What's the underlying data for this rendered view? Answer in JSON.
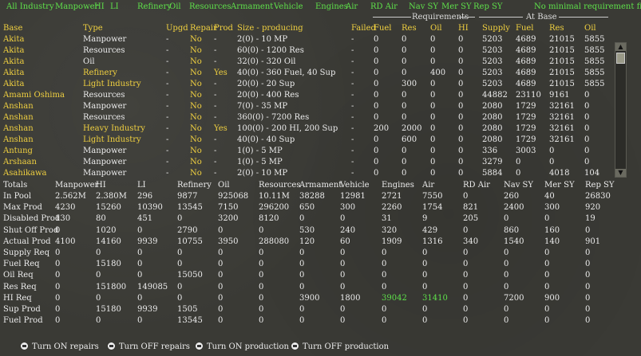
{
  "filters": [
    "All Industry",
    "Manpower",
    "HI",
    "LI",
    "Refinery",
    "Oil",
    "Resources",
    "Armament",
    "Vehicle",
    "Engines",
    "Air",
    "RD Air",
    "Nav SY",
    "Mer SY",
    "Rep SY"
  ],
  "filter_note": "No minimal requirement filter",
  "group_headers": {
    "requirements": "Requirements",
    "at_base": "At Base"
  },
  "columns": [
    "Base",
    "Type",
    "Upgd",
    "Repair",
    "Prod",
    "Size - producing",
    "Failed",
    "Fuel",
    "Res",
    "Oil",
    "HI",
    "Supply",
    "Fuel",
    "Res",
    "Oil"
  ],
  "rows": [
    {
      "base": "Akita",
      "type": "Manpower",
      "upgd": "-",
      "repair": "No",
      "prod": "-",
      "size": "2(0) - 10 MP",
      "failed": "-",
      "rfuel": "0",
      "rres": "0",
      "roil": "0",
      "rhi": "0",
      "supply": "5203",
      "fuel": "4689",
      "res": "21015",
      "oil": "5855",
      "color": "yel"
    },
    {
      "base": "Akita",
      "type": "Resources",
      "upgd": "-",
      "repair": "No",
      "prod": "-",
      "size": "60(0) - 1200 Res",
      "failed": "-",
      "rfuel": "0",
      "rres": "0",
      "roil": "0",
      "rhi": "0",
      "supply": "5203",
      "fuel": "4689",
      "res": "21015",
      "oil": "5855",
      "color": "yel"
    },
    {
      "base": "Akita",
      "type": "Oil",
      "upgd": "-",
      "repair": "No",
      "prod": "-",
      "size": "32(0) - 320 Oil",
      "failed": "-",
      "rfuel": "0",
      "rres": "0",
      "roil": "0",
      "rhi": "0",
      "supply": "5203",
      "fuel": "4689",
      "res": "21015",
      "oil": "5855",
      "color": "yel"
    },
    {
      "base": "Akita",
      "type": "Refinery",
      "upgd": "-",
      "repair": "No",
      "prod": "Yes",
      "size": "40(0) - 360 Fuel, 40 Sup",
      "failed": "-",
      "rfuel": "0",
      "rres": "0",
      "roil": "400",
      "rhi": "0",
      "supply": "5203",
      "fuel": "4689",
      "res": "21015",
      "oil": "5855",
      "color": "yel",
      "typecolor": "yel"
    },
    {
      "base": "Akita",
      "type": "Light Industry",
      "upgd": "-",
      "repair": "No",
      "prod": "-",
      "size": "20(0) - 20 Sup",
      "failed": "-",
      "rfuel": "0",
      "rres": "300",
      "roil": "0",
      "rhi": "0",
      "supply": "5203",
      "fuel": "4689",
      "res": "21015",
      "oil": "5855",
      "color": "yel",
      "typecolor": "yel"
    },
    {
      "base": "Amami Oshima",
      "type": "Resources",
      "upgd": "-",
      "repair": "No",
      "prod": "-",
      "size": "20(0) - 400 Res",
      "failed": "-",
      "rfuel": "0",
      "rres": "0",
      "roil": "0",
      "rhi": "0",
      "supply": "44882",
      "fuel": "23110",
      "res": "9161",
      "oil": "0",
      "color": "yel"
    },
    {
      "base": "Anshan",
      "type": "Manpower",
      "upgd": "-",
      "repair": "No",
      "prod": "-",
      "size": "7(0) - 35 MP",
      "failed": "-",
      "rfuel": "0",
      "rres": "0",
      "roil": "0",
      "rhi": "0",
      "supply": "2080",
      "fuel": "1729",
      "res": "32161",
      "oil": "0",
      "color": "yel"
    },
    {
      "base": "Anshan",
      "type": "Resources",
      "upgd": "-",
      "repair": "No",
      "prod": "-",
      "size": "360(0) - 7200 Res",
      "failed": "-",
      "rfuel": "0",
      "rres": "0",
      "roil": "0",
      "rhi": "0",
      "supply": "2080",
      "fuel": "1729",
      "res": "32161",
      "oil": "0",
      "color": "yel"
    },
    {
      "base": "Anshan",
      "type": "Heavy Industry",
      "upgd": "-",
      "repair": "No",
      "prod": "Yes",
      "size": "100(0) - 200 HI, 200 Sup",
      "failed": "-",
      "rfuel": "200",
      "rres": "2000",
      "roil": "0",
      "rhi": "0",
      "supply": "2080",
      "fuel": "1729",
      "res": "32161",
      "oil": "0",
      "color": "yel",
      "typecolor": "yel"
    },
    {
      "base": "Anshan",
      "type": "Light Industry",
      "upgd": "-",
      "repair": "No",
      "prod": "-",
      "size": "40(0) - 40 Sup",
      "failed": "-",
      "rfuel": "0",
      "rres": "600",
      "roil": "0",
      "rhi": "0",
      "supply": "2080",
      "fuel": "1729",
      "res": "32161",
      "oil": "0",
      "color": "yel",
      "typecolor": "yel"
    },
    {
      "base": "Antung",
      "type": "Manpower",
      "upgd": "-",
      "repair": "No",
      "prod": "-",
      "size": "1(0) - 5 MP",
      "failed": "-",
      "rfuel": "0",
      "rres": "0",
      "roil": "0",
      "rhi": "0",
      "supply": "336",
      "fuel": "3003",
      "res": "0",
      "oil": "0",
      "color": "yel"
    },
    {
      "base": "Arshaan",
      "type": "Manpower",
      "upgd": "-",
      "repair": "No",
      "prod": "-",
      "size": "1(0) - 5 MP",
      "failed": "-",
      "rfuel": "0",
      "rres": "0",
      "roil": "0",
      "rhi": "0",
      "supply": "3279",
      "fuel": "0",
      "res": "0",
      "oil": "0",
      "color": "yel"
    },
    {
      "base": "Asahikawa",
      "type": "Manpower",
      "upgd": "-",
      "repair": "No",
      "prod": "-",
      "size": "2(0) - 10 MP",
      "failed": "-",
      "rfuel": "0",
      "rres": "0",
      "roil": "0",
      "rhi": "0",
      "supply": "5884",
      "fuel": "0",
      "res": "4018",
      "oil": "104",
      "color": "yel"
    }
  ],
  "stats_columns": [
    "Totals",
    "Manpower",
    "HI",
    "LI",
    "Refinery",
    "Oil",
    "Resources",
    "Armament",
    "Vehicle",
    "Engines",
    "Air",
    "RD Air",
    "Nav SY",
    "Mer SY",
    "Rep SY"
  ],
  "stats": [
    [
      "In Pool",
      "2.562M",
      "2.380M",
      "296",
      "9877",
      "925068",
      "10.11M",
      "38288",
      "12981",
      "2721",
      "7550",
      "0",
      "260",
      "40",
      "26830"
    ],
    [
      "Max Prod",
      "4230",
      "15260",
      "10390",
      "13545",
      "7150",
      "296200",
      "650",
      "300",
      "2260",
      "1754",
      "821",
      "2400",
      "300",
      "920"
    ],
    [
      "Disabled Prod",
      "130",
      "80",
      "451",
      "0",
      "3200",
      "8120",
      "0",
      "0",
      "31",
      "9",
      "205",
      "0",
      "0",
      "19"
    ],
    [
      "Shut Off Prod",
      "0",
      "1020",
      "0",
      "2790",
      "0",
      "0",
      "530",
      "240",
      "320",
      "429",
      "0",
      "860",
      "160",
      "0"
    ],
    [
      "Actual Prod",
      "4100",
      "14160",
      "9939",
      "10755",
      "3950",
      "288080",
      "120",
      "60",
      "1909",
      "1316",
      "340",
      "1540",
      "140",
      "901"
    ],
    [
      "Supply Req",
      "0",
      "0",
      "0",
      "0",
      "0",
      "0",
      "0",
      "0",
      "0",
      "0",
      "0",
      "0",
      "0",
      "0"
    ],
    [
      "Fuel Req",
      "0",
      "15180",
      "0",
      "0",
      "0",
      "0",
      "0",
      "0",
      "0",
      "0",
      "0",
      "0",
      "0",
      "0"
    ],
    [
      "Oil Req",
      "0",
      "0",
      "0",
      "15050",
      "0",
      "0",
      "0",
      "0",
      "0",
      "0",
      "0",
      "0",
      "0",
      "0"
    ],
    [
      "Res Req",
      "0",
      "151800",
      "149085",
      "0",
      "0",
      "0",
      "0",
      "0",
      "0",
      "0",
      "0",
      "0",
      "0",
      "0"
    ],
    [
      "HI Req",
      "0",
      "0",
      "0",
      "0",
      "0",
      "0",
      "3900",
      "1800",
      "39042",
      "31410",
      "0",
      "7200",
      "900",
      "0"
    ],
    [
      "Sup Prod",
      "0",
      "15180",
      "9939",
      "1505",
      "0",
      "0",
      "0",
      "0",
      "0",
      "0",
      "0",
      "0",
      "0",
      "0"
    ],
    [
      "Fuel Prod",
      "0",
      "0",
      "0",
      "13545",
      "0",
      "0",
      "0",
      "0",
      "0",
      "0",
      "0",
      "0",
      "0",
      "0"
    ]
  ],
  "actions": [
    "Turn ON repairs",
    "Turn OFF repairs",
    "Turn ON production",
    "Turn OFF production"
  ],
  "colors": {
    "accent_green": "#5ee04a",
    "yellow": "#f0d040",
    "text": "#ececec",
    "bg": "#3a3a35"
  }
}
